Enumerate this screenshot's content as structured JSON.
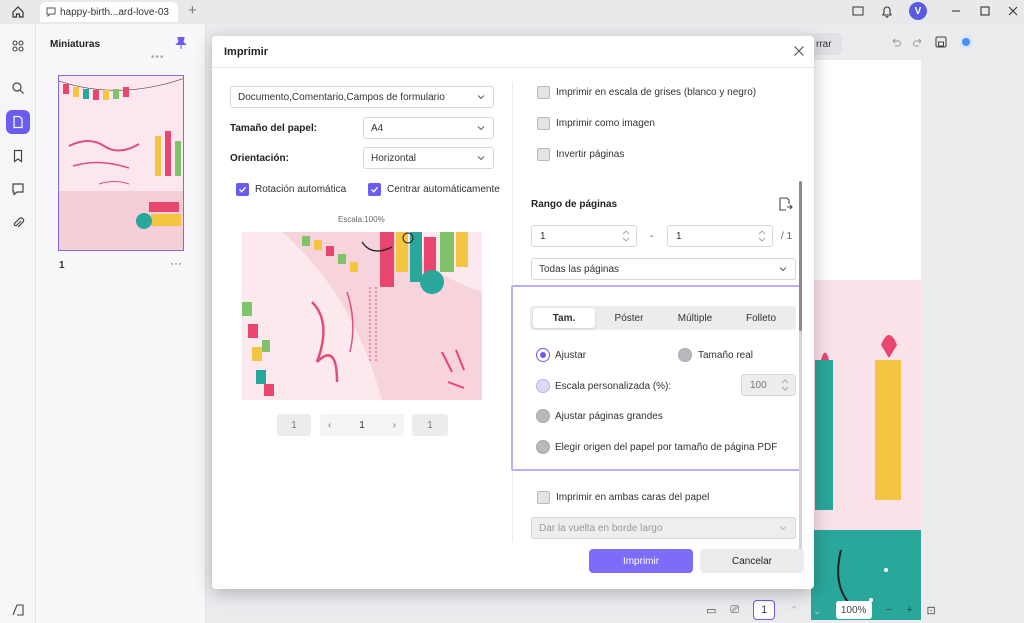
{
  "titlebar": {
    "tab_title": "happy-birth...ard-love-03",
    "new_tab": "+",
    "avatar_initial": "V"
  },
  "thumbnails": {
    "title": "Miniaturas",
    "page_number": "1",
    "more": "···"
  },
  "document": {
    "close_fragment": "rrar",
    "current_page": "1",
    "zoom": "100%"
  },
  "dialog": {
    "title": "Imprimir",
    "content_select": "Documento,Comentario,Campos de formulario",
    "paper_size_label": "Tamaño del papel:",
    "paper_size_value": "A4",
    "orientation_label": "Orientación:",
    "orientation_value": "Horizontal",
    "auto_rotate": "Rotación automática",
    "auto_center": "Centrar automáticamente",
    "scale_label": "Escala:100%",
    "pager": {
      "first": "1",
      "current": "1",
      "last": "1",
      "prev": "‹",
      "next": "›"
    },
    "grayscale": "Imprimir en escala de grises (blanco y negro)",
    "as_image": "Imprimir como imagen",
    "invert": "Invertir páginas",
    "page_range_label": "Rango de páginas",
    "range_from": "1",
    "range_dash": "-",
    "range_to": "1",
    "range_total": "/ 1",
    "range_select": "Todas las páginas",
    "tabs": [
      "Tam.",
      "Póster",
      "Múltiple",
      "Folleto"
    ],
    "fit": "Ajustar",
    "actual_size": "Tamaño real",
    "custom_scale": "Escala personalizada (%):",
    "custom_scale_value": "100",
    "fit_large": "Ajustar páginas grandes",
    "paper_source": "Elegir origen del papel por tamaño de página PDF",
    "duplex": "Imprimir en ambas caras del papel",
    "duplex_select": "Dar la vuelta en borde largo",
    "print_button": "Imprimir",
    "cancel_button": "Cancelar"
  },
  "colors": {
    "accent": "#6b5cf0",
    "primary_button": "#7c6cf7",
    "highlight": "#b7b0f3"
  }
}
